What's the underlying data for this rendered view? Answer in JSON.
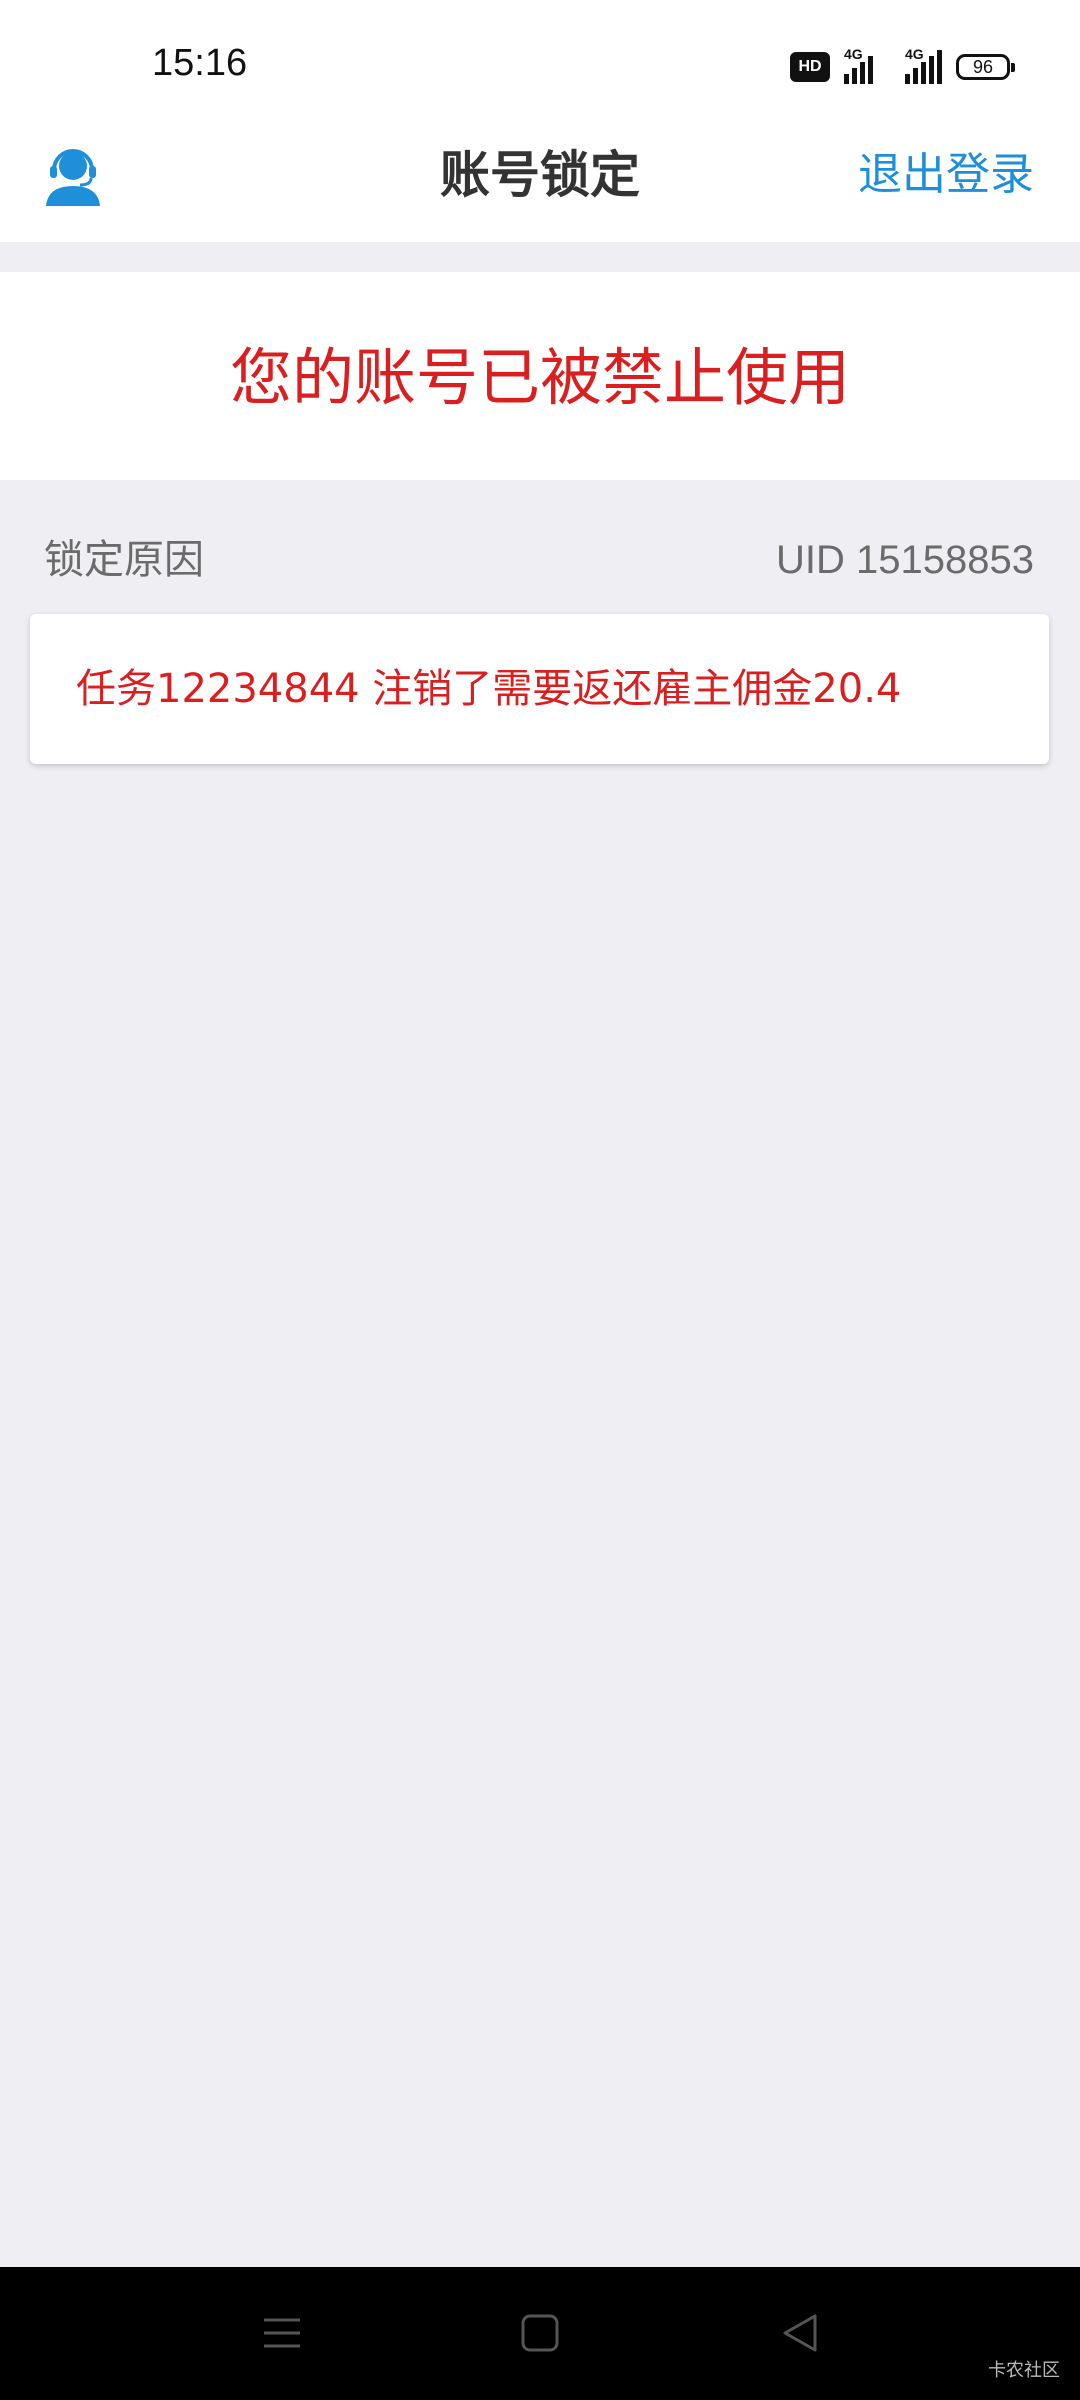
{
  "status_bar": {
    "time": "15:16",
    "hd_label": "HD",
    "signal1_label": "4G",
    "signal2_label": "4G",
    "battery": "96"
  },
  "header": {
    "title": "账号锁定",
    "logout_label": "退出登录",
    "support_icon": "customer-service-icon"
  },
  "banner": {
    "message": "您的账号已被禁止使用"
  },
  "lock_info": {
    "reason_label": "锁定原因",
    "uid_text": "UID 15158853",
    "reason_text": "任务12234844 注销了需要返还雇主佣金20.4"
  },
  "nav_bar": {
    "menu_icon": "menu-icon",
    "home_icon": "home-icon",
    "back_icon": "back-icon",
    "watermark": "卡农社区"
  },
  "colors": {
    "accent_blue": "#1E8FD8",
    "warning_red": "#D91F1F",
    "background": "#EEEEF3"
  }
}
